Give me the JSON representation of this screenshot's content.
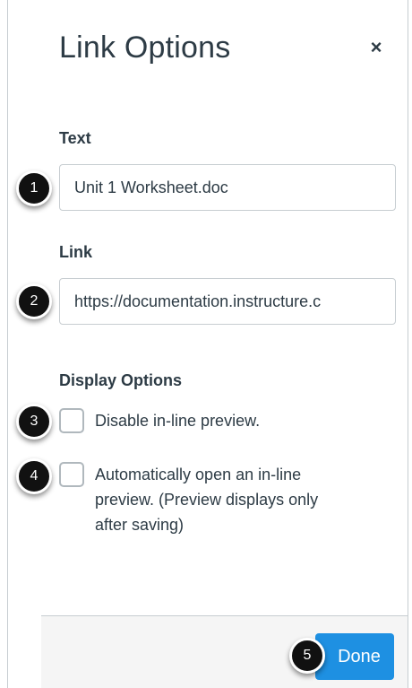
{
  "dialog": {
    "title": "Link Options",
    "close_label": "×"
  },
  "text_field": {
    "label": "Text",
    "value": "Unit 1 Worksheet.doc"
  },
  "link_field": {
    "label": "Link",
    "value": "https://documentation.instructure.c"
  },
  "display_options": {
    "heading": "Display Options",
    "disable_preview": {
      "label": "Disable in-line preview.",
      "checked": false
    },
    "auto_open": {
      "line1": "Automatically open an in-line",
      "line2": "preview. (Preview displays only",
      "line3": "after saving)",
      "checked": false
    }
  },
  "footer": {
    "done_label": "Done"
  },
  "callouts": [
    "1",
    "2",
    "3",
    "4",
    "5"
  ],
  "colors": {
    "primary_button": "#1e90e2",
    "callout_badge": "#111111",
    "text": "#2d3b45",
    "border": "#c7cdd1"
  }
}
